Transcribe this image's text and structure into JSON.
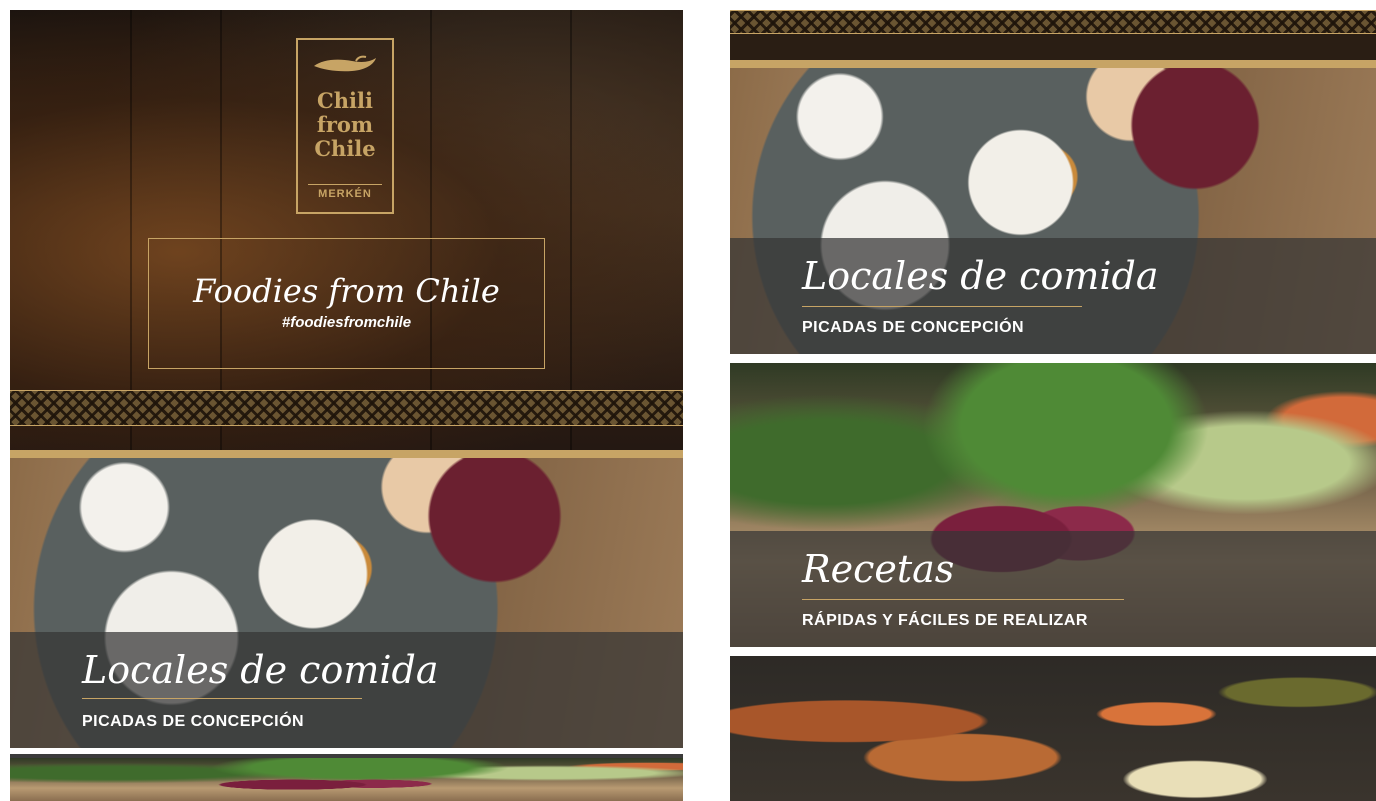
{
  "brand": {
    "logo_lines": [
      "Chili",
      "from",
      "Chile"
    ],
    "logo_sub": "MERKÉN"
  },
  "hero": {
    "title": "Foodies from Chile",
    "hashtag": "#foodiesfromchile"
  },
  "cards": {
    "locales": {
      "title": "Locales de comida",
      "subtitle": "PICADAS DE CONCEPCIÓN"
    },
    "recetas": {
      "title": "Recetas",
      "subtitle": "RÁPIDAS Y FÁCILES DE REALIZAR"
    }
  },
  "colors": {
    "gold": "#c7a465",
    "caption_band": "#343434",
    "hero_dark": "#1c140f"
  }
}
